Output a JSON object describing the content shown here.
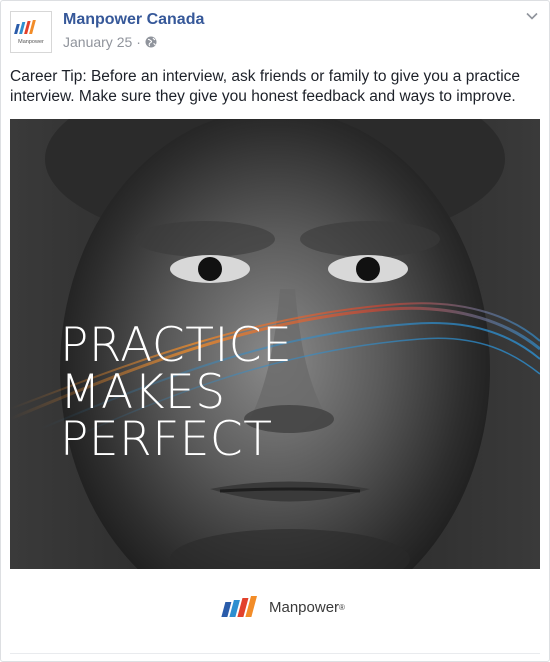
{
  "post": {
    "page_name": "Manpower Canada",
    "date": "January 25",
    "separator": "·",
    "audience_icon": "globe-icon",
    "menu_icon": "chevron-down-icon",
    "text": "Career Tip: Before an interview, ask friends or family to give you a practice interview. Make sure they give you honest feedback and ways to improve."
  },
  "avatar": {
    "logo_text": "Manpower"
  },
  "image": {
    "overlay_lines": [
      "PRACTICE",
      "MAKES",
      "PERFECT"
    ]
  },
  "brand": {
    "name": "Manpower",
    "reg_mark": "®",
    "stripe_colors": [
      "#2a5caa",
      "#2d8fd0",
      "#e2412c",
      "#f28c28"
    ]
  },
  "colors": {
    "link_blue": "#365899",
    "meta_grey": "#90949c",
    "text_dark": "#1d2129"
  }
}
